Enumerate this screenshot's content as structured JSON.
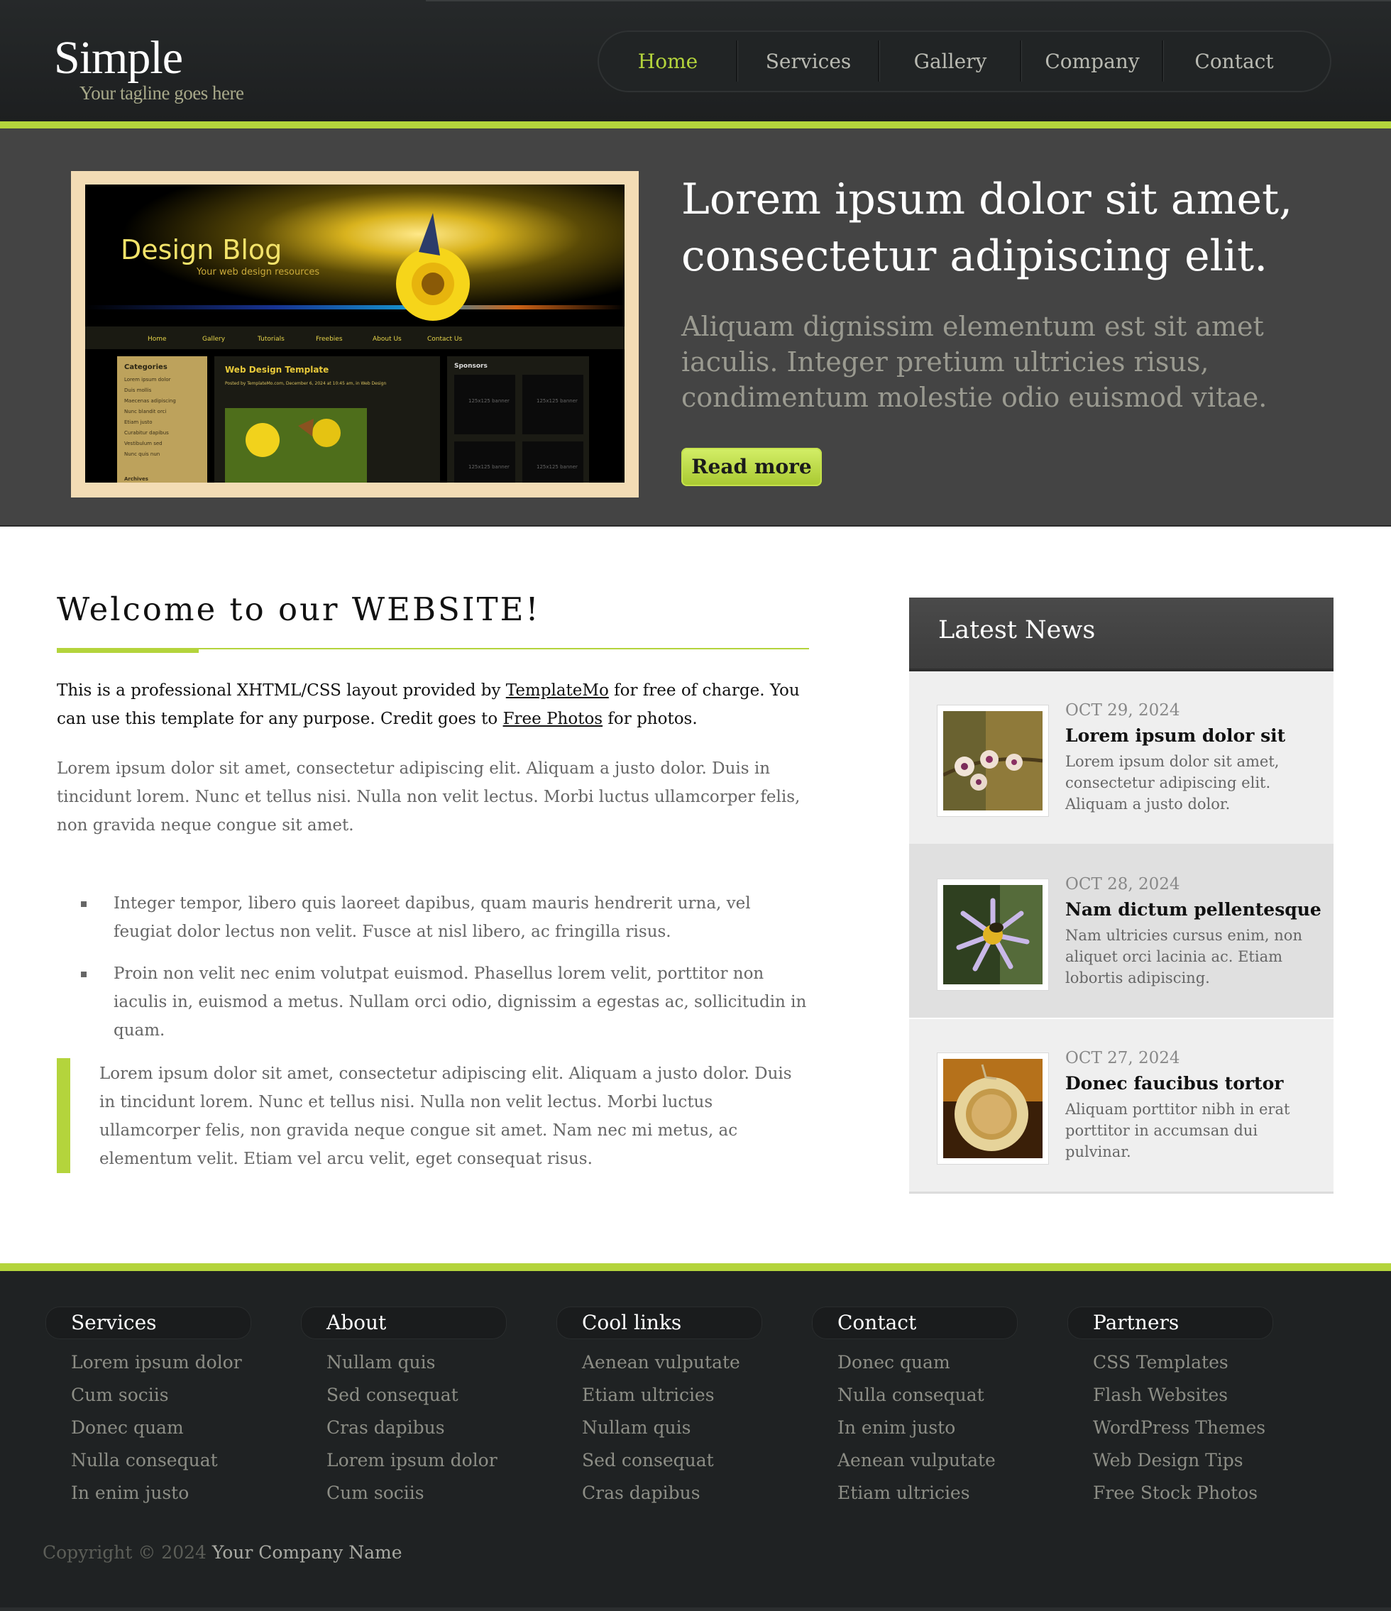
{
  "header": {
    "logo_title": "Simple",
    "tagline": "Your tagline goes here",
    "nav": [
      {
        "label": "Home",
        "active": true
      },
      {
        "label": "Services",
        "active": false
      },
      {
        "label": "Gallery",
        "active": false
      },
      {
        "label": "Company",
        "active": false
      },
      {
        "label": "Contact",
        "active": false
      }
    ]
  },
  "hero": {
    "screenshot": {
      "brand": "Design Blog",
      "brand_sub": "Your web design resources",
      "nav": [
        "Home",
        "Gallery",
        "Tutorials",
        "Freebies",
        "About Us",
        "Contact Us"
      ],
      "sidebar_title": "Categories",
      "sidebar_items": [
        "Lorem ipsum dolor",
        "Duis mollis",
        "Maecenas adipiscing",
        "Nunc blandit orci",
        "Etiam justo",
        "Curabitur dapibus",
        "Vestibulum sed",
        "Nunc quis nun"
      ],
      "sidebar_bottom": "Archives",
      "post_title": "Web Design Template",
      "post_meta": "Posted by TemplateMo.com, December 6, 2024 at 10:45 am, in Web Design",
      "sponsors": "Sponsors",
      "banner_label": "125x125 banner"
    },
    "title": "Lorem ipsum dolor sit amet, consectetur adipiscing elit.",
    "text": "Aliquam dignissim elementum est sit amet iaculis. Integer pretium ultricies risus, condimentum molestie odio euismod vitae.",
    "button": "Read more"
  },
  "main": {
    "welcome_title": "Welcome to our WEBSITE!",
    "intro": {
      "before_link1": "This is a professional XHTML/CSS layout provided by ",
      "link1": "TemplateMo",
      "middle": " for free of charge. You can use this template for any purpose. Credit goes to ",
      "link2": "Free Photos",
      "after": " for photos."
    },
    "paragraph": "Lorem ipsum dolor sit amet, consectetur adipiscing elit. Aliquam a justo dolor. Duis in tincidunt lorem. Nunc et tellus nisi. Nulla non velit lectus. Morbi luctus ullamcorper felis, non gravida neque congue sit amet.",
    "bullets": [
      "Integer tempor, libero quis laoreet dapibus, quam mauris hendrerit urna, vel feugiat dolor lectus non velit. Fusce at nisl libero, ac fringilla risus.",
      "Proin non velit nec enim volutpat euismod. Phasellus lorem velit, porttitor non iaculis in, euismod a metus. Nullam orci odio, dignissim a egestas ac, sollicitudin in quam."
    ],
    "quote": "Lorem ipsum dolor sit amet, consectetur adipiscing elit. Aliquam a justo dolor. Duis in tincidunt lorem. Nunc et tellus nisi. Nulla non velit lectus. Morbi luctus ullamcorper felis, non gravida neque congue sit amet. Nam nec mi metus, ac elementum velit. Etiam vel arcu velit, eget consequat risus."
  },
  "news": {
    "title": "Latest News",
    "items": [
      {
        "date": "OCT 29, 2024",
        "title": "Lorem ipsum dolor sit",
        "desc": "Lorem ipsum dolor sit amet, consectetur adipiscing elit. Aliquam a justo dolor.",
        "icon": "orchid-photo"
      },
      {
        "date": "OCT 28, 2024",
        "title": "Nam dictum pellentesque",
        "desc": "Nam ultricies cursus enim, non aliquet orci lacinia ac. Etiam lobortis adipiscing.",
        "icon": "aster-bee-photo"
      },
      {
        "date": "OCT 27, 2024",
        "title": "Donec faucibus tortor",
        "desc": "Aliquam porttitor nibh in erat porttitor in accumsan dui pulvinar.",
        "icon": "coffee-cup-photo"
      }
    ]
  },
  "footer": {
    "columns": [
      {
        "heading": "Services",
        "links": [
          "Lorem ipsum dolor",
          "Cum sociis",
          "Donec quam",
          "Nulla consequat",
          "In enim justo"
        ]
      },
      {
        "heading": "About",
        "links": [
          "Nullam quis",
          "Sed consequat",
          "Cras dapibus",
          "Lorem ipsum dolor",
          "Cum sociis"
        ]
      },
      {
        "heading": "Cool links",
        "links": [
          "Aenean vulputate",
          "Etiam ultricies",
          "Nullam quis",
          "Sed consequat",
          "Cras dapibus"
        ]
      },
      {
        "heading": "Contact",
        "links": [
          "Donec quam",
          "Nulla consequat",
          "In enim justo",
          "Aenean vulputate",
          "Etiam ultricies"
        ]
      },
      {
        "heading": "Partners",
        "links": [
          "CSS Templates",
          "Flash Websites",
          "WordPress Themes",
          "Web Design Tips",
          "Free Stock Photos"
        ]
      }
    ],
    "copyright_prefix": "Copyright © 2024 ",
    "company": "Your Company Name"
  },
  "colors": {
    "accent": "#b4d43c",
    "header_bg": "#222526",
    "hero_bg": "#444444",
    "footer_bg": "#1f2223"
  }
}
